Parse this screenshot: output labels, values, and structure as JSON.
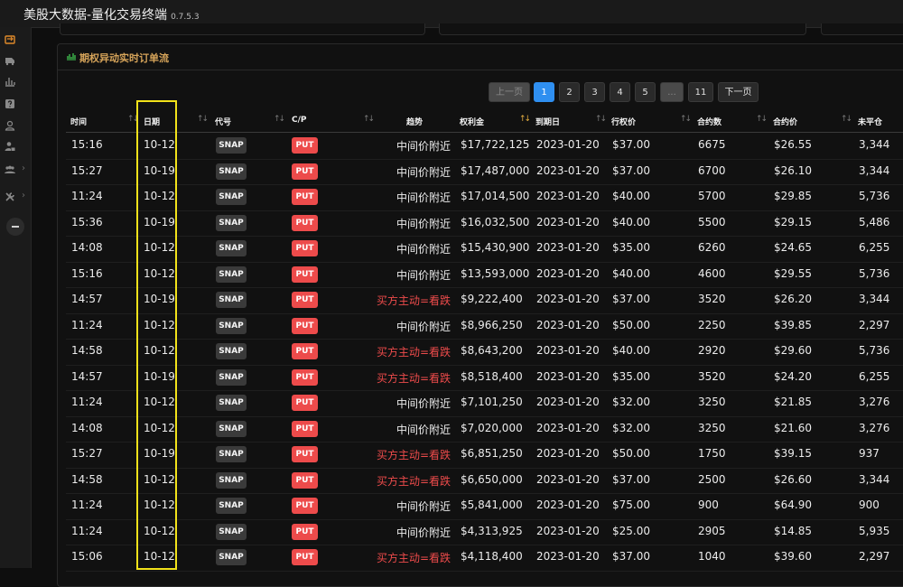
{
  "app": {
    "title": "美股大数据-量化交易终端",
    "version": "0.7.5.3"
  },
  "colors": {
    "accent": "#2f8ff0",
    "put": "#ed4b4b",
    "title": "#d6a45a",
    "bearish": "#ed4b4b",
    "highlight": "#f2e21a"
  },
  "sidebar": {
    "items": [
      {
        "icon": "exchange-icon",
        "chevron": false
      },
      {
        "icon": "bus-icon",
        "chevron": false
      },
      {
        "icon": "bar-chart-icon",
        "chevron": false
      },
      {
        "icon": "question-icon",
        "chevron": false
      },
      {
        "icon": "user-icon",
        "chevron": false
      },
      {
        "icon": "user-lock-icon",
        "chevron": false
      },
      {
        "icon": "users-icon",
        "chevron": true,
        "chevron_char": "›"
      },
      {
        "icon": "tools-icon",
        "chevron": true,
        "chevron_char": "›"
      }
    ]
  },
  "panel": {
    "title": "期权异动实时订单流",
    "icon": "line-chart-icon"
  },
  "pagination": {
    "prev": "上一页",
    "next": "下一页",
    "ellipsis": "...",
    "pages": [
      "1",
      "2",
      "3",
      "4",
      "5"
    ],
    "last": "11",
    "current": "1"
  },
  "table": {
    "columns": [
      "时间",
      "日期",
      "代号",
      "C/P",
      "趋势",
      "权利金",
      "到期日",
      "行权价",
      "合约数",
      "合约价",
      "未平仓"
    ],
    "rows": [
      {
        "time": "15:16",
        "date": "10-12",
        "symbol": "SNAP",
        "cp": "PUT",
        "trend": "中间价附近",
        "premium": "$17,722,125",
        "expiry": "2023-01-20",
        "strike": "$37.00",
        "contracts": "6675",
        "price": "$26.55",
        "oi": "3,344"
      },
      {
        "time": "15:27",
        "date": "10-19",
        "symbol": "SNAP",
        "cp": "PUT",
        "trend": "中间价附近",
        "premium": "$17,487,000",
        "expiry": "2023-01-20",
        "strike": "$37.00",
        "contracts": "6700",
        "price": "$26.10",
        "oi": "3,344"
      },
      {
        "time": "11:24",
        "date": "10-12",
        "symbol": "SNAP",
        "cp": "PUT",
        "trend": "中间价附近",
        "premium": "$17,014,500",
        "expiry": "2023-01-20",
        "strike": "$40.00",
        "contracts": "5700",
        "price": "$29.85",
        "oi": "5,736"
      },
      {
        "time": "15:36",
        "date": "10-19",
        "symbol": "SNAP",
        "cp": "PUT",
        "trend": "中间价附近",
        "premium": "$16,032,500",
        "expiry": "2023-01-20",
        "strike": "$40.00",
        "contracts": "5500",
        "price": "$29.15",
        "oi": "5,486"
      },
      {
        "time": "14:08",
        "date": "10-12",
        "symbol": "SNAP",
        "cp": "PUT",
        "trend": "中间价附近",
        "premium": "$15,430,900",
        "expiry": "2023-01-20",
        "strike": "$35.00",
        "contracts": "6260",
        "price": "$24.65",
        "oi": "6,255"
      },
      {
        "time": "15:16",
        "date": "10-12",
        "symbol": "SNAP",
        "cp": "PUT",
        "trend": "中间价附近",
        "premium": "$13,593,000",
        "expiry": "2023-01-20",
        "strike": "$40.00",
        "contracts": "4600",
        "price": "$29.55",
        "oi": "5,736"
      },
      {
        "time": "14:57",
        "date": "10-19",
        "symbol": "SNAP",
        "cp": "PUT",
        "trend": "买方主动=看跌",
        "premium": "$9,222,400",
        "expiry": "2023-01-20",
        "strike": "$37.00",
        "contracts": "3520",
        "price": "$26.20",
        "oi": "3,344"
      },
      {
        "time": "11:24",
        "date": "10-12",
        "symbol": "SNAP",
        "cp": "PUT",
        "trend": "中间价附近",
        "premium": "$8,966,250",
        "expiry": "2023-01-20",
        "strike": "$50.00",
        "contracts": "2250",
        "price": "$39.85",
        "oi": "2,297"
      },
      {
        "time": "14:58",
        "date": "10-12",
        "symbol": "SNAP",
        "cp": "PUT",
        "trend": "买方主动=看跌",
        "premium": "$8,643,200",
        "expiry": "2023-01-20",
        "strike": "$40.00",
        "contracts": "2920",
        "price": "$29.60",
        "oi": "5,736"
      },
      {
        "time": "14:57",
        "date": "10-19",
        "symbol": "SNAP",
        "cp": "PUT",
        "trend": "买方主动=看跌",
        "premium": "$8,518,400",
        "expiry": "2023-01-20",
        "strike": "$35.00",
        "contracts": "3520",
        "price": "$24.20",
        "oi": "6,255"
      },
      {
        "time": "11:24",
        "date": "10-12",
        "symbol": "SNAP",
        "cp": "PUT",
        "trend": "中间价附近",
        "premium": "$7,101,250",
        "expiry": "2023-01-20",
        "strike": "$32.00",
        "contracts": "3250",
        "price": "$21.85",
        "oi": "3,276"
      },
      {
        "time": "14:08",
        "date": "10-12",
        "symbol": "SNAP",
        "cp": "PUT",
        "trend": "中间价附近",
        "premium": "$7,020,000",
        "expiry": "2023-01-20",
        "strike": "$32.00",
        "contracts": "3250",
        "price": "$21.60",
        "oi": "3,276"
      },
      {
        "time": "15:27",
        "date": "10-19",
        "symbol": "SNAP",
        "cp": "PUT",
        "trend": "买方主动=看跌",
        "premium": "$6,851,250",
        "expiry": "2023-01-20",
        "strike": "$50.00",
        "contracts": "1750",
        "price": "$39.15",
        "oi": "937"
      },
      {
        "time": "14:58",
        "date": "10-12",
        "symbol": "SNAP",
        "cp": "PUT",
        "trend": "买方主动=看跌",
        "premium": "$6,650,000",
        "expiry": "2023-01-20",
        "strike": "$37.00",
        "contracts": "2500",
        "price": "$26.60",
        "oi": "3,344"
      },
      {
        "time": "11:24",
        "date": "10-12",
        "symbol": "SNAP",
        "cp": "PUT",
        "trend": "中间价附近",
        "premium": "$5,841,000",
        "expiry": "2023-01-20",
        "strike": "$75.00",
        "contracts": "900",
        "price": "$64.90",
        "oi": "900"
      },
      {
        "time": "11:24",
        "date": "10-12",
        "symbol": "SNAP",
        "cp": "PUT",
        "trend": "中间价附近",
        "premium": "$4,313,925",
        "expiry": "2023-01-20",
        "strike": "$25.00",
        "contracts": "2905",
        "price": "$14.85",
        "oi": "5,935"
      },
      {
        "time": "15:06",
        "date": "10-12",
        "symbol": "SNAP",
        "cp": "PUT",
        "trend": "买方主动=看跌",
        "premium": "$4,118,400",
        "expiry": "2023-01-20",
        "strike": "$37.00",
        "contracts": "1040",
        "price": "$39.60",
        "oi": "2,297"
      }
    ]
  }
}
